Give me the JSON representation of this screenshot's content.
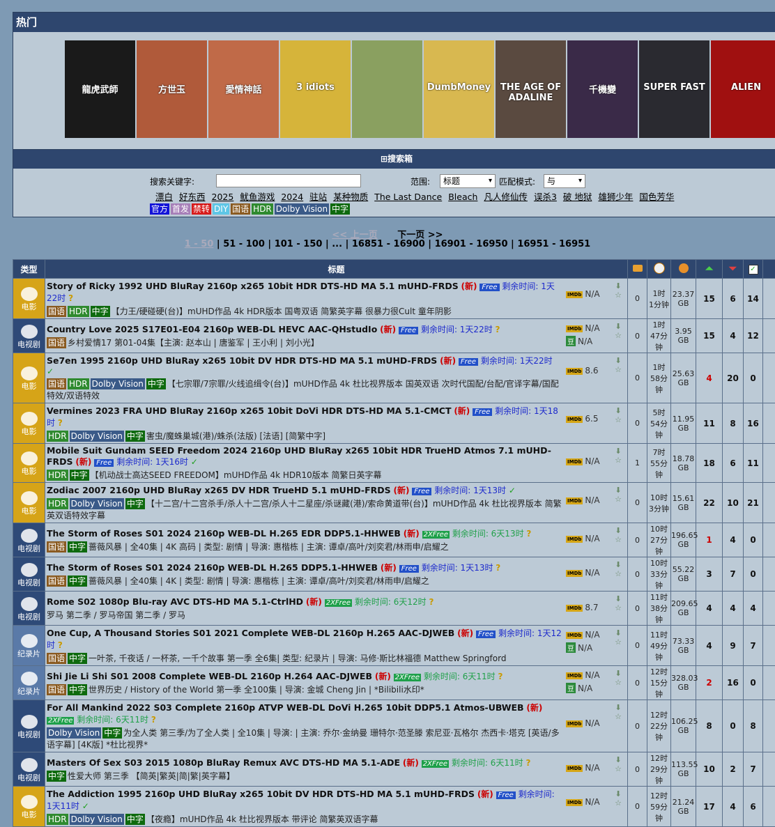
{
  "hot": {
    "title": "热门",
    "posters": [
      {
        "label": "龍虎武師",
        "bg": "#1a1a1a"
      },
      {
        "label": "方世玉",
        "bg": "#b05a3a"
      },
      {
        "label": "愛情神話",
        "bg": "#c06a48"
      },
      {
        "label": "3 idiots",
        "bg": "#d6b43a"
      },
      {
        "label": "",
        "bg": "#8aa060"
      },
      {
        "label": "DumbMoney",
        "bg": "#d8b850"
      },
      {
        "label": "THE AGE OF ADALINE",
        "bg": "#5a4a40"
      },
      {
        "label": "千機變",
        "bg": "#3a2a48"
      },
      {
        "label": "SUPER FAST",
        "bg": "#2a2a30"
      },
      {
        "label": "ALIEN",
        "bg": "#a01010"
      }
    ]
  },
  "search": {
    "toggle_label": "搜索箱",
    "keyword_label": "搜索关键字:",
    "keyword_value": "",
    "scope_label": "范围:",
    "scope_value": "标题",
    "match_label": "匹配模式:",
    "match_value": "与",
    "hot_keywords": [
      "漂白",
      "好东西",
      "2025",
      "鱿鱼游戏",
      "2024",
      "驻站",
      "某种物质",
      "The Last Dance",
      "Bleach",
      "凡人修仙传",
      "误杀3",
      "破 地狱",
      "雄狮少年",
      "国色芳华"
    ],
    "tags": [
      {
        "label": "官方",
        "color": "#1414d8"
      },
      {
        "label": "首发",
        "color": "#a77fb8"
      },
      {
        "label": "禁转",
        "color": "#d81c1c"
      },
      {
        "label": "DIY",
        "color": "#5ec6e6"
      },
      {
        "label": "国语",
        "color": "#8a5a20"
      },
      {
        "label": "HDR",
        "color": "#2f8a2f"
      },
      {
        "label": "Dolby Vision",
        "color": "#3a5a88"
      },
      {
        "label": "中字",
        "color": "#0e6a0e"
      }
    ]
  },
  "pager": {
    "prev": "<< 上一页",
    "next": "下一页 >>",
    "current": "1 - 50",
    "pages": [
      "51 - 100",
      "101 - 150",
      "...",
      "16851 - 16900",
      "16901 - 16950",
      "16951 - 16951"
    ]
  },
  "table": {
    "headers": {
      "type": "类型",
      "title": "标题"
    },
    "rows": [
      {
        "cat": "电影",
        "name": "Story of Ricky 1992 UHD BluRay 2160p x265 10bit HDR DTS-HD MA 5.1 mUHD-FRDS",
        "new": "(新)",
        "free": "Free",
        "remain": "剩余时间: 1天22时",
        "mark": "?",
        "tags": [
          "国语",
          "HDR",
          "中字"
        ],
        "desc": "【力王/硬碰硬(台)】mUHD作品 4k HDR版本 国粤双语 简繁英字幕 很暴力很Cult 童年阴影",
        "imdb": "N/A",
        "douban": "",
        "comments": "0",
        "time": "1时\n1分钟",
        "size": "23.37\nGB",
        "seed": "15",
        "leech": "6",
        "done": "14",
        "seedred": false
      },
      {
        "cat": "电视剧",
        "name": "Country Love 2025 S17E01-E04 2160p WEB-DL HEVC AAC-QHstudIo",
        "new": "(新)",
        "free": "Free",
        "remain": "剩余时间: 1天22时",
        "mark": "?",
        "tags": [
          "国语"
        ],
        "desc": "乡村爱情17 第01-04集【主演: 赵本山 | 唐鉴军 | 王小利 | 刘小光】",
        "imdb": "N/A",
        "douban": "N/A",
        "comments": "0",
        "time": "1时\n47分钟",
        "size": "3.95\nGB",
        "seed": "15",
        "leech": "4",
        "done": "12",
        "seedred": false
      },
      {
        "cat": "电影",
        "name": "Se7en 1995 2160p UHD BluRay x265 10bit DV HDR DTS-HD MA 5.1 mUHD-FRDS",
        "new": "(新)",
        "free": "Free",
        "remain": "剩余时间: 1天22时",
        "mark": "✓",
        "tags": [
          "国语",
          "HDR",
          "Dolby Vision",
          "中字"
        ],
        "desc": "【七宗罪/7宗罪/火线追缉令(台)】mUHD作品 4k 杜比视界版本 国英双语 次时代国配/台配/官译字幕/国配特效/双语特效",
        "imdb": "8.6",
        "douban": "",
        "comments": "0",
        "time": "1时\n58分钟",
        "size": "25.63\nGB",
        "seed": "4",
        "leech": "20",
        "done": "0",
        "seedred": true
      },
      {
        "cat": "电影",
        "name": "Vermines 2023 FRA UHD BluRay 2160p x265 10bit DoVi HDR DTS-HD MA 5.1-CMCT",
        "new": "(新)",
        "free": "Free",
        "remain": "剩余时间: 1天18时",
        "mark": "?",
        "tags": [
          "HDR",
          "Dolby Vision",
          "中字"
        ],
        "desc": "害虫/魔蛛巢城(港)/蛛杀(法版) [法语] [简繁中字]",
        "imdb": "6.5",
        "douban": "",
        "comments": "0",
        "time": "5时\n54分钟",
        "size": "11.95\nGB",
        "seed": "11",
        "leech": "8",
        "done": "16",
        "seedred": false
      },
      {
        "cat": "电影",
        "name": "Mobile Suit Gundam SEED Freedom 2024 2160p UHD BluRay x265 10bit HDR TrueHD Atmos 7.1 mUHD-FRDS",
        "new": "(新)",
        "free": "Free",
        "remain": "剩余时间: 1天16时",
        "mark": "✓",
        "tags": [
          "HDR",
          "中字"
        ],
        "desc": "【机动战士高达SEED FREEDOM】mUHD作品 4k HDR10版本 简繁日英字幕",
        "imdb": "N/A",
        "douban": "",
        "comments": "1",
        "time": "7时\n55分钟",
        "size": "18.78\nGB",
        "seed": "18",
        "leech": "6",
        "done": "11",
        "seedred": false
      },
      {
        "cat": "电影",
        "name": "Zodiac 2007 2160p UHD BluRay x265 DV HDR TrueHD 5.1 mUHD-FRDS",
        "new": "(新)",
        "free": "Free",
        "remain": "剩余时间: 1天13时",
        "mark": "✓",
        "tags": [
          "HDR",
          "Dolby Vision",
          "中字"
        ],
        "desc": "【十二宫/十二宫杀手/杀人十二宫/杀人十二星座/杀谜藏(港)/索命黄道带(台)】mUHD作品 4k 杜比视界版本 简繁英双语特效字幕",
        "imdb": "N/A",
        "douban": "",
        "comments": "0",
        "time": "10时\n3分钟",
        "size": "15.61\nGB",
        "seed": "22",
        "leech": "10",
        "done": "21",
        "seedred": false
      },
      {
        "cat": "电视剧",
        "name": "The Storm of Roses S01 2024 2160p WEB-DL H.265 EDR DDP5.1-HHWEB",
        "new": "(新)",
        "free": "2XFree",
        "remain": "剩余时间: 6天13时",
        "mark": "?",
        "tags": [
          "国语",
          "中字"
        ],
        "desc": "蔷薇风暴 | 全40集 | 4K 高码 | 类型: 剧情 | 导演: 惠楷栋 | 主演: 谭卓/高叶/刘奕君/林雨申/启耀之",
        "imdb": "N/A",
        "douban": "",
        "comments": "0",
        "time": "10时\n27分钟",
        "size": "196.65\nGB",
        "seed": "1",
        "leech": "4",
        "done": "0",
        "seedred": true
      },
      {
        "cat": "电视剧",
        "name": "The Storm of Roses S01 2024 2160p WEB-DL H.265 DDP5.1-HHWEB",
        "new": "(新)",
        "free": "Free",
        "remain": "剩余时间: 1天13时",
        "mark": "?",
        "tags": [
          "国语",
          "中字"
        ],
        "desc": "蔷薇风暴 | 全40集 | 4K | 类型: 剧情 | 导演: 惠楷栋 | 主演: 谭卓/高叶/刘奕君/林雨申/启耀之",
        "imdb": "N/A",
        "douban": "",
        "comments": "0",
        "time": "10时\n33分钟",
        "size": "55.22\nGB",
        "seed": "3",
        "leech": "7",
        "done": "0",
        "seedred": false
      },
      {
        "cat": "电视剧",
        "name": "Rome S02 1080p Blu-ray AVC DTS-HD MA 5.1-CtrlHD",
        "new": "(新)",
        "free": "2XFree",
        "remain": "剩余时间: 6天12时",
        "mark": "?",
        "tags": [],
        "desc": "罗马 第二季 / 罗马帝国 第二季 / 罗马",
        "imdb": "8.7",
        "douban": "",
        "comments": "0",
        "time": "11时\n38分钟",
        "size": "209.65\nGB",
        "seed": "4",
        "leech": "4",
        "done": "4",
        "seedred": false
      },
      {
        "cat": "纪录片",
        "name": "One Cup, A Thousand Stories S01 2021 Complete WEB-DL 2160p H.265 AAC-DJWEB",
        "new": "(新)",
        "free": "Free",
        "remain": "剩余时间: 1天12时",
        "mark": "?",
        "tags": [
          "国语",
          "中字"
        ],
        "desc": "一叶茶, 千夜话 / 一杯茶, 一千个故事 第一季 全6集| 类型: 纪录片 | 导演: 马修·斯比林福德 Matthew Springford",
        "imdb": "N/A",
        "douban": "N/A",
        "comments": "0",
        "time": "11时\n49分钟",
        "size": "73.33\nGB",
        "seed": "4",
        "leech": "9",
        "done": "7",
        "seedred": false
      },
      {
        "cat": "纪录片",
        "name": "Shi Jie Li Shi S01 2008 Complete WEB-DL 2160p H.264 AAC-DJWEB",
        "new": "(新)",
        "free": "2XFree",
        "remain": "剩余时间: 6天11时",
        "mark": "?",
        "tags": [
          "国语",
          "中字"
        ],
        "desc": "世界历史 / History of the World 第一季 全100集 | 导演: 金城 Cheng Jin | *Bilibili水印*",
        "imdb": "N/A",
        "douban": "N/A",
        "comments": "0",
        "time": "12时\n15分钟",
        "size": "328.03\nGB",
        "seed": "2",
        "leech": "16",
        "done": "0",
        "seedred": true
      },
      {
        "cat": "电视剧",
        "name": "For All Mankind 2022 S03 Complete 2160p ATVP WEB-DL DoVi H.265 10bit DDP5.1 Atmos-UBWEB",
        "new": "(新)",
        "free": "2XFree",
        "remain": "剩余时间: 6天11时",
        "mark": "?",
        "tags": [
          "Dolby Vision",
          "中字"
        ],
        "desc": "为全人类 第三季/为了全人类 | 全10集 | 导演: | 主演: 乔尔·金纳曼 珊特尔·范圣滕 索尼亚·瓦格尔 杰西卡·塔克 [英语/多语字幕] [4K版] *杜比视界*",
        "imdb": "N/A",
        "douban": "",
        "comments": "0",
        "time": "12时\n22分钟",
        "size": "106.25\nGB",
        "seed": "8",
        "leech": "0",
        "done": "8",
        "seedred": false
      },
      {
        "cat": "电视剧",
        "name": "Masters Of Sex S03 2015 1080p BluRay Remux AVC DTS-HD MA 5.1-ADE",
        "new": "(新)",
        "free": "2XFree",
        "remain": "剩余时间: 6天11时",
        "mark": "?",
        "tags": [
          "中字"
        ],
        "desc": "性爱大师 第三季 【简英|繁英|简|繁|英字幕】",
        "imdb": "N/A",
        "douban": "",
        "comments": "0",
        "time": "12时\n29分钟",
        "size": "113.55\nGB",
        "seed": "10",
        "leech": "2",
        "done": "7",
        "seedred": false
      },
      {
        "cat": "电影",
        "name": "The Addiction 1995 2160p UHD BluRay x265 10bit DV HDR DTS-HD MA 5.1 mUHD-FRDS",
        "new": "(新)",
        "free": "Free",
        "remain": "剩余时间: 1天11时",
        "mark": "✓",
        "tags": [
          "HDR",
          "Dolby Vision",
          "中字"
        ],
        "desc": "【夜瘾】mUHD作品 4k 杜比视界版本 带评论 简繁英双语字幕",
        "imdb": "N/A",
        "douban": "",
        "comments": "0",
        "time": "12时\n59分钟",
        "size": "21.24\nGB",
        "seed": "17",
        "leech": "4",
        "done": "6",
        "seedred": false
      }
    ]
  },
  "tag_colors": {
    "国语": "#8a5a20",
    "HDR": "#2f8a2f",
    "Dolby Vision": "#3a5a88",
    "中字": "#0e6a0e"
  },
  "cat_colors": {
    "电影": "#d6a418",
    "电视剧": "#2e4a78",
    "纪录片": "#5a7aa8"
  }
}
